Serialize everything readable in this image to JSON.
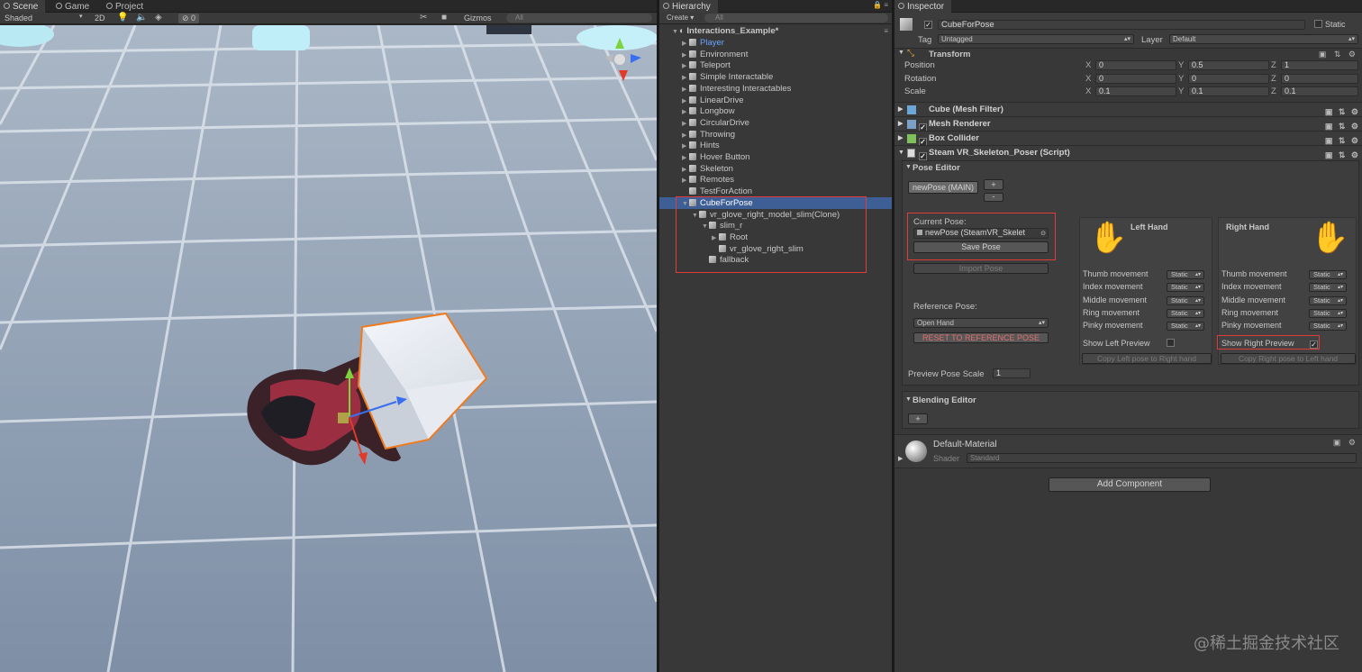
{
  "scene": {
    "tabs": [
      "Scene",
      "Game",
      "Project"
    ],
    "shading": "Shaded",
    "mode_2d": "2D",
    "hidden_count": "0",
    "gizmos": "Gizmos",
    "search_placeholder": "All"
  },
  "hierarchy": {
    "tab": "Hierarchy",
    "create": "Create",
    "search_placeholder": "All",
    "scene_name": "Interactions_Example*",
    "items": [
      {
        "label": "Player",
        "depth": 1,
        "arrow": true,
        "highlight": true
      },
      {
        "label": "Environment",
        "depth": 1,
        "arrow": true
      },
      {
        "label": "Teleport",
        "depth": 1,
        "arrow": true
      },
      {
        "label": "Simple Interactable",
        "depth": 1,
        "arrow": true
      },
      {
        "label": "Interesting Interactables",
        "depth": 1,
        "arrow": true
      },
      {
        "label": "LinearDrive",
        "depth": 1,
        "arrow": true
      },
      {
        "label": "Longbow",
        "depth": 1,
        "arrow": true
      },
      {
        "label": "CircularDrive",
        "depth": 1,
        "arrow": true
      },
      {
        "label": "Throwing",
        "depth": 1,
        "arrow": true
      },
      {
        "label": "Hints",
        "depth": 1,
        "arrow": true
      },
      {
        "label": "Hover Button",
        "depth": 1,
        "arrow": true
      },
      {
        "label": "Skeleton",
        "depth": 1,
        "arrow": true
      },
      {
        "label": "Remotes",
        "depth": 1,
        "arrow": true
      },
      {
        "label": "TestForAction",
        "depth": 1,
        "arrow": false
      },
      {
        "label": "CubeForPose",
        "depth": 1,
        "arrow": "open",
        "selected": true
      },
      {
        "label": "vr_glove_right_model_slim(Clone)",
        "depth": 2,
        "arrow": "open"
      },
      {
        "label": "slim_r",
        "depth": 3,
        "arrow": "open"
      },
      {
        "label": "Root",
        "depth": 4,
        "arrow": true
      },
      {
        "label": "vr_glove_right_slim",
        "depth": 4,
        "arrow": false
      },
      {
        "label": "fallback",
        "depth": 3,
        "arrow": false
      }
    ]
  },
  "inspector": {
    "tab": "Inspector",
    "object_name": "CubeForPose",
    "static_label": "Static",
    "tag_label": "Tag",
    "tag_value": "Untagged",
    "layer_label": "Layer",
    "layer_value": "Default",
    "transform": {
      "title": "Transform",
      "rows": [
        {
          "label": "Position",
          "x": "0",
          "y": "0.5",
          "z": "1"
        },
        {
          "label": "Rotation",
          "x": "0",
          "y": "0",
          "z": "0"
        },
        {
          "label": "Scale",
          "x": "0.1",
          "y": "0.1",
          "z": "0.1"
        }
      ],
      "axis_x": "X",
      "axis_y": "Y",
      "axis_z": "Z"
    },
    "components": [
      "Cube (Mesh Filter)",
      "Mesh Renderer",
      "Box Collider",
      "Steam VR_Skeleton_Poser (Script)"
    ],
    "pose_editor": {
      "title": "Pose Editor",
      "pose_button": "newPose (MAIN)",
      "plus": "+",
      "minus": "-",
      "current_pose_label": "Current Pose:",
      "current_pose_value": "newPose (SteamVR_Skelet",
      "save_pose": "Save Pose",
      "import_pose": "Import Pose",
      "reference_pose_label": "Reference Pose:",
      "reference_pose_value": "Open Hand",
      "reset_button": "RESET TO REFERENCE POSE",
      "left_hand": "Left Hand",
      "right_hand": "Right Hand",
      "movement_rows": [
        "Thumb movement",
        "Index movement",
        "Middle movement",
        "Ring movement",
        "Pinky movement"
      ],
      "movement_value": "Static",
      "show_left_preview": "Show Left Preview",
      "show_right_preview": "Show Right Preview",
      "copy_left": "Copy Left pose to Right hand",
      "copy_right": "Copy Right pose to Left hand",
      "preview_scale_label": "Preview Pose Scale",
      "preview_scale_value": "1"
    },
    "blending_editor": {
      "title": "Blending Editor",
      "plus": "+"
    },
    "material": {
      "name": "Default-Material",
      "shader_label": "Shader",
      "shader_value": "Standard"
    },
    "add_component": "Add Component"
  },
  "watermark": "@稀土掘金技术社区",
  "colors": {
    "selection": "#3e5f96",
    "highlight_text": "#6aa2ff",
    "red_box": "#e23b3b",
    "cube_outline": "#f07a1e"
  }
}
